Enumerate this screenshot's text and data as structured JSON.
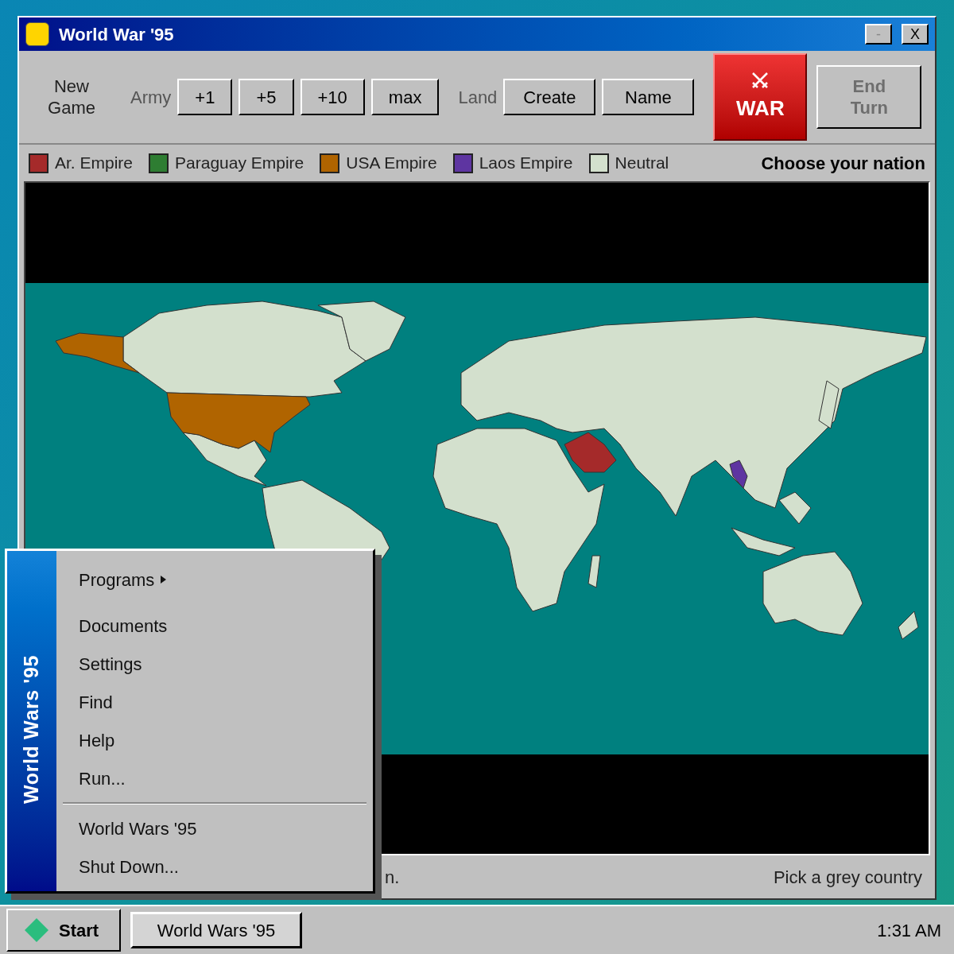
{
  "window": {
    "title": "World War '95",
    "controls": [
      "-",
      "X"
    ]
  },
  "toolbar": {
    "new_game": "New Game",
    "army_label": "Army",
    "army_buttons": [
      "+1",
      "+5",
      "+10",
      "max"
    ],
    "land_label": "Land",
    "land_buttons": [
      "Create",
      "Name"
    ],
    "war_button": "WAR",
    "end_turn": {
      "label": "End Turn",
      "disabled": true
    }
  },
  "legend": {
    "items": [
      {
        "label": "Ar. Empire",
        "color": "#a52a2a"
      },
      {
        "label": "Paraguay Empire",
        "color": "#2e7d32"
      },
      {
        "label": "USA Empire",
        "color": "#b06400"
      },
      {
        "label": "Laos Empire",
        "color": "#5e35a1"
      },
      {
        "label": "Neutral",
        "color": "#d3e0cd"
      }
    ],
    "prompt": "Choose your nation"
  },
  "status_bar": {
    "left": "n.",
    "right": "Pick a grey country"
  },
  "start_menu": {
    "side_title": "World Wars '95",
    "items": [
      {
        "label": "Programs",
        "submenu": true
      },
      {
        "label": "Documents",
        "submenu": false
      },
      {
        "label": "Settings",
        "submenu": false
      },
      {
        "label": "Find",
        "submenu": false
      },
      {
        "label": "Help",
        "submenu": false
      },
      {
        "label": "Run...",
        "submenu": false
      }
    ],
    "footer_items": [
      "World Wars '95",
      "Shut Down..."
    ]
  },
  "taskbar": {
    "start": "Start",
    "tasks": [
      "World Wars '95"
    ],
    "clock": "1:31 AM"
  }
}
